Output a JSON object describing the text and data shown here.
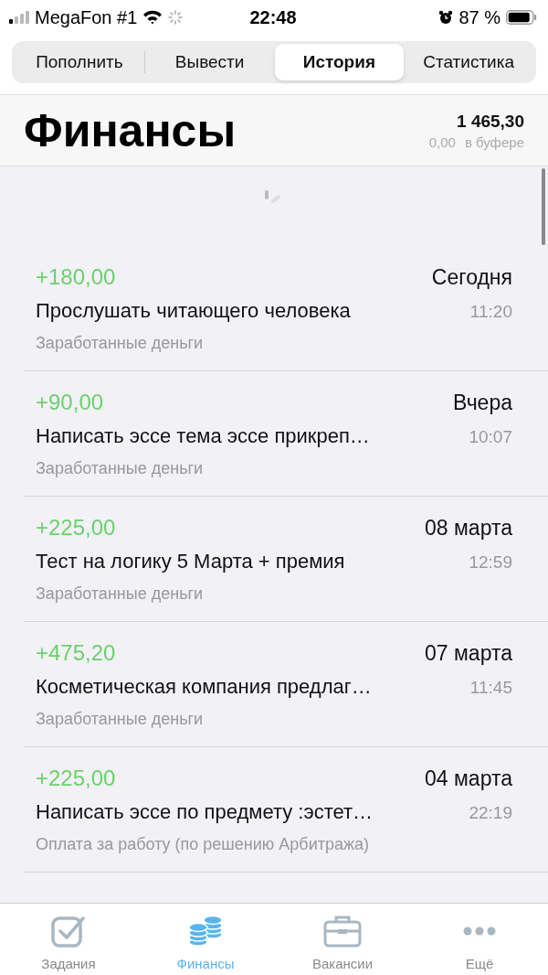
{
  "status_bar": {
    "carrier": "MegaFon #1",
    "time": "22:48",
    "battery": "87 %"
  },
  "tabs": [
    {
      "label": "Пополнить",
      "selected": false
    },
    {
      "label": "Вывести",
      "selected": false
    },
    {
      "label": "История",
      "selected": true
    },
    {
      "label": "Статистика",
      "selected": false
    }
  ],
  "header": {
    "title": "Финансы",
    "balance": "1 465,30",
    "buffer_amount": "0,00",
    "buffer_label": "в буфере"
  },
  "transactions": [
    {
      "kind": "income",
      "amount": "+180,00",
      "date": "Сегодня",
      "title": "Прослушать читающего человека",
      "time": "11:20",
      "category": "Заработанные деньги"
    },
    {
      "kind": "income",
      "amount": "+90,00",
      "date": "Вчера",
      "title": "Написать эссе тема эссе прикреп…",
      "time": "10:07",
      "category": "Заработанные деньги"
    },
    {
      "kind": "income",
      "amount": "+225,00",
      "date": "08 марта",
      "title": "Тест на логику 5 Марта + премия",
      "time": "12:59",
      "category": "Заработанные деньги"
    },
    {
      "kind": "income",
      "amount": "+475,20",
      "date": "07 марта",
      "title": "Косметическая компания предлаг…",
      "time": "11:45",
      "category": "Заработанные деньги"
    },
    {
      "kind": "income",
      "amount": "+225,00",
      "date": "04 марта",
      "title": "Написать эссе по предмету :эстет…",
      "time": "22:19",
      "category": "Оплата за работу (по решению Арбитража)"
    }
  ],
  "tab_bar": [
    {
      "label": "Задания",
      "selected": false
    },
    {
      "label": "Финансы",
      "selected": true
    },
    {
      "label": "Вакансии",
      "selected": false
    },
    {
      "label": "Ещё",
      "selected": false
    }
  ]
}
